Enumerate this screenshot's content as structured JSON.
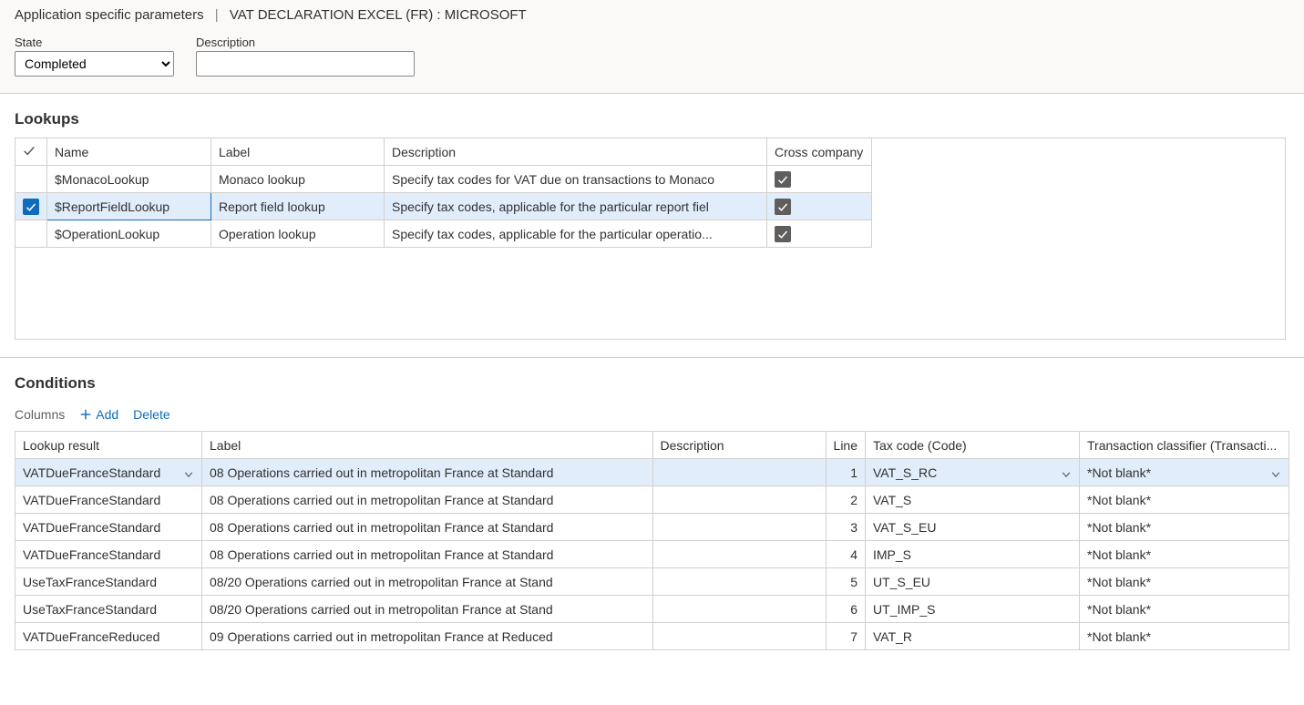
{
  "breadcrumb": {
    "page": "Application specific parameters",
    "context": "VAT DECLARATION EXCEL (FR) : MICROSOFT"
  },
  "filters": {
    "state_label": "State",
    "state_value": "Completed",
    "description_label": "Description",
    "description_value": ""
  },
  "lookups": {
    "title": "Lookups",
    "headers": {
      "name": "Name",
      "label": "Label",
      "description": "Description",
      "cross": "Cross company"
    },
    "rows": [
      {
        "selected": false,
        "name": "$MonacoLookup",
        "label": "Monaco lookup",
        "description": "Specify tax codes for VAT due on transactions to Monaco",
        "cross": true
      },
      {
        "selected": true,
        "name": "$ReportFieldLookup",
        "label": "Report field lookup",
        "description": "Specify tax codes, applicable for the particular report fiel",
        "cross": true
      },
      {
        "selected": false,
        "name": "$OperationLookup",
        "label": "Operation lookup",
        "description": "Specify tax codes, applicable for the particular operatio...",
        "cross": true
      }
    ]
  },
  "conditions": {
    "title": "Conditions",
    "toolbar": {
      "columns": "Columns",
      "add": "Add",
      "delete": "Delete"
    },
    "headers": {
      "lookup": "Lookup result",
      "label": "Label",
      "description": "Description",
      "line": "Line",
      "taxcode": "Tax code (Code)",
      "txclass": "Transaction classifier (Transacti..."
    },
    "rows": [
      {
        "selected": true,
        "lookup": "VATDueFranceStandard",
        "label": "08 Operations carried out in metropolitan France at Standard",
        "description": "",
        "line": "1",
        "taxcode": "VAT_S_RC",
        "txclass": "*Not blank*"
      },
      {
        "selected": false,
        "lookup": "VATDueFranceStandard",
        "label": "08 Operations carried out in metropolitan France at Standard",
        "description": "",
        "line": "2",
        "taxcode": "VAT_S",
        "txclass": "*Not blank*"
      },
      {
        "selected": false,
        "lookup": "VATDueFranceStandard",
        "label": "08 Operations carried out in metropolitan France at Standard",
        "description": "",
        "line": "3",
        "taxcode": "VAT_S_EU",
        "txclass": "*Not blank*"
      },
      {
        "selected": false,
        "lookup": "VATDueFranceStandard",
        "label": "08 Operations carried out in metropolitan France at Standard",
        "description": "",
        "line": "4",
        "taxcode": "IMP_S",
        "txclass": "*Not blank*"
      },
      {
        "selected": false,
        "lookup": "UseTaxFranceStandard",
        "label": "08/20 Operations carried out in metropolitan France at Stand",
        "description": "",
        "line": "5",
        "taxcode": "UT_S_EU",
        "txclass": "*Not blank*"
      },
      {
        "selected": false,
        "lookup": "UseTaxFranceStandard",
        "label": "08/20 Operations carried out in metropolitan France at Stand",
        "description": "",
        "line": "6",
        "taxcode": "UT_IMP_S",
        "txclass": "*Not blank*"
      },
      {
        "selected": false,
        "lookup": "VATDueFranceReduced",
        "label": "09 Operations carried out in metropolitan France at Reduced",
        "description": "",
        "line": "7",
        "taxcode": "VAT_R",
        "txclass": "*Not blank*"
      }
    ]
  }
}
